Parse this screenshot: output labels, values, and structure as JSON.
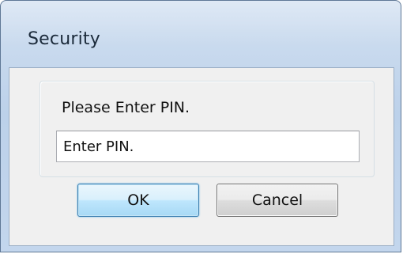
{
  "dialog": {
    "title": "Security",
    "prompt": "Please Enter PIN.",
    "pin_field": {
      "value": "",
      "placeholder": "Enter PIN."
    },
    "buttons": {
      "ok_label": "OK",
      "cancel_label": "Cancel"
    }
  }
}
